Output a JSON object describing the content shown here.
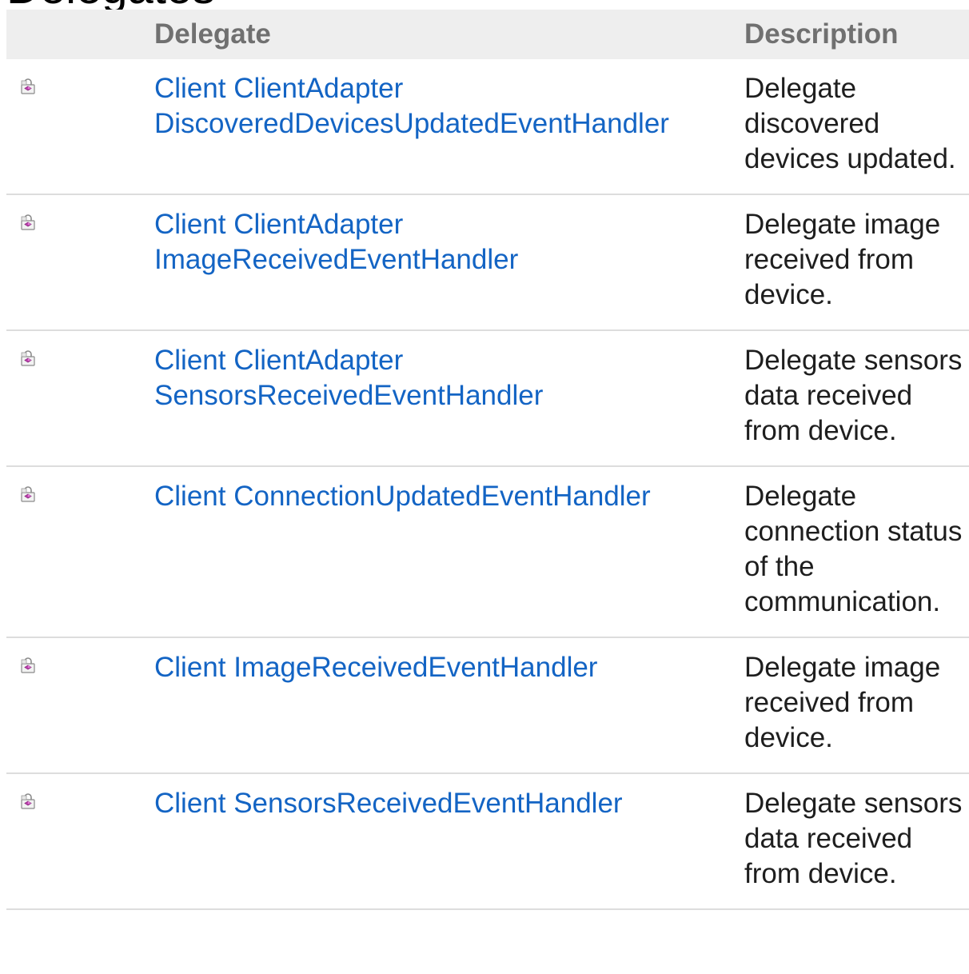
{
  "section_title": "Delegates",
  "table": {
    "headers": {
      "icon": "",
      "delegate": "Delegate",
      "description": "Description"
    },
    "rows": [
      {
        "icon": "public-delegate-icon",
        "name_line1": "Client ClientAdapter",
        "name_line2": "DiscoveredDevicesUpdatedEventHandler",
        "description": "Delegate discovered devices updated."
      },
      {
        "icon": "public-delegate-icon",
        "name_line1": "Client ClientAdapter",
        "name_line2": "ImageReceivedEventHandler",
        "description": "Delegate image received from device."
      },
      {
        "icon": "public-delegate-icon",
        "name_line1": "Client ClientAdapter",
        "name_line2": "SensorsReceivedEventHandler",
        "description": "Delegate sensors data received from device."
      },
      {
        "icon": "public-delegate-icon",
        "name_line1": "Client ConnectionUpdatedEventHandler",
        "name_line2": "",
        "description": "Delegate connection status of the communication."
      },
      {
        "icon": "public-delegate-icon",
        "name_line1": "Client ImageReceivedEventHandler",
        "name_line2": "",
        "description": "Delegate image received from device."
      },
      {
        "icon": "public-delegate-icon",
        "name_line1": "Client SensorsReceivedEventHandler",
        "name_line2": "",
        "description": "Delegate sensors data received from device."
      }
    ]
  },
  "colors": {
    "link": "#1364c4",
    "header_bg": "#eeeeee",
    "header_text": "#707070",
    "row_border": "#dddddd",
    "icon_pink": "#c040b0"
  }
}
